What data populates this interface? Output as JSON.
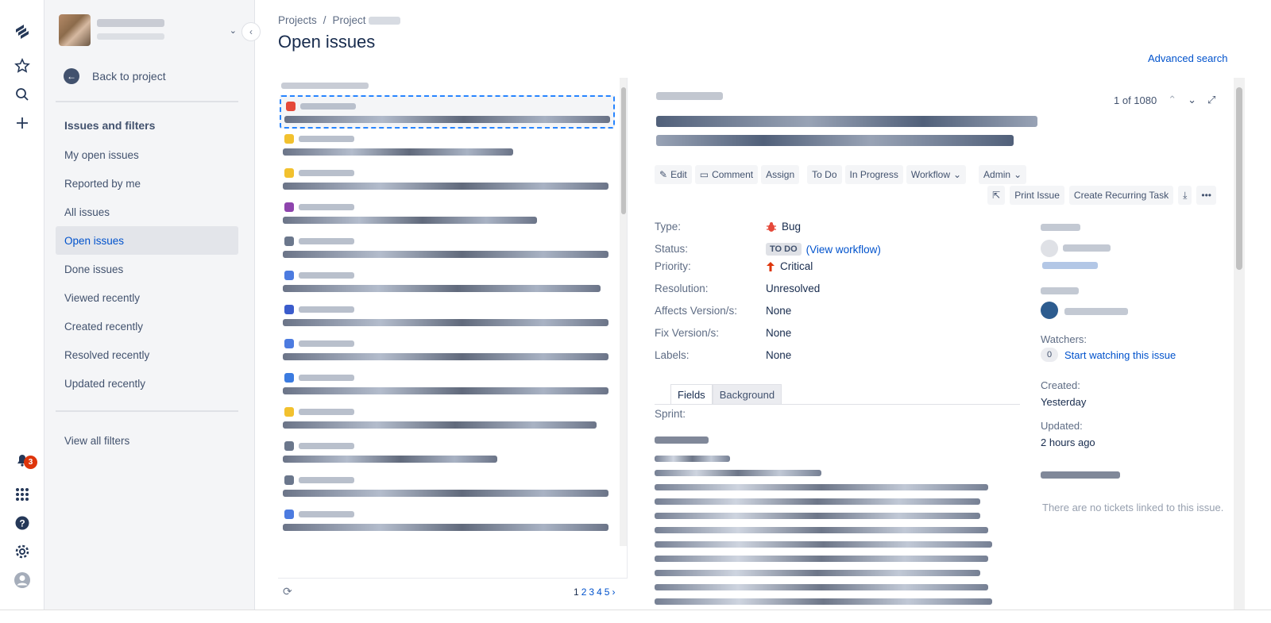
{
  "global_nav": {
    "notification_count": "3",
    "icons": [
      "jira-logo-icon",
      "star-icon",
      "search-icon",
      "plus-icon",
      "bell-icon",
      "apps-grid-icon",
      "help-icon",
      "settings-icon",
      "user-avatar-icon"
    ]
  },
  "sidebar": {
    "back_label": "Back to project",
    "section_title": "Issues and filters",
    "items": [
      {
        "label": "My open issues",
        "active": false
      },
      {
        "label": "Reported by me",
        "active": false
      },
      {
        "label": "All issues",
        "active": false
      },
      {
        "label": "Open issues",
        "active": true
      },
      {
        "label": "Done issues",
        "active": false
      },
      {
        "label": "Viewed recently",
        "active": false
      },
      {
        "label": "Created recently",
        "active": false
      },
      {
        "label": "Resolved recently",
        "active": false
      },
      {
        "label": "Updated recently",
        "active": false
      }
    ],
    "view_all_filters": "View all filters"
  },
  "breadcrumb": {
    "projects": "Projects",
    "separator": "/",
    "project": "Project"
  },
  "page_title": "Open issues",
  "advanced_search": "Advanced search",
  "issue_list": {
    "pages": [
      "1",
      "2",
      "3",
      "4",
      "5"
    ],
    "next": "›"
  },
  "detail": {
    "counter": "1 of 1080",
    "buttons": {
      "edit": "Edit",
      "comment": "Comment",
      "assign": "Assign",
      "todo": "To Do",
      "in_progress": "In Progress",
      "workflow": "Workflow",
      "admin": "Admin",
      "print": "Print Issue",
      "recurring": "Create Recurring Task"
    },
    "fields": {
      "type_label": "Type:",
      "type_value": "Bug",
      "status_label": "Status:",
      "status_value": "TO DO",
      "view_workflow": "(View workflow)",
      "priority_label": "Priority:",
      "priority_value": "Critical",
      "resolution_label": "Resolution:",
      "resolution_value": "Unresolved",
      "affects_label": "Affects Version/s:",
      "affects_value": "None",
      "fix_label": "Fix Version/s:",
      "fix_value": "None",
      "labels_label": "Labels:",
      "labels_value": "None"
    },
    "tabs": {
      "fields": "Fields",
      "background": "Background"
    },
    "sprint_label": "Sprint:",
    "right": {
      "watchers_label": "Watchers:",
      "watch_count": "0",
      "watch_link": "Start watching this issue",
      "created_label": "Created:",
      "created_value": "Yesterday",
      "updated_label": "Updated:",
      "updated_value": "2 hours ago",
      "no_tickets": "There are no tickets linked to this issue."
    }
  },
  "colors": {
    "accent": "#0052cc",
    "active_bg": "#e3e5ea",
    "badge": "#de350b",
    "bug": "#e5493a",
    "priority": "#de350b"
  }
}
